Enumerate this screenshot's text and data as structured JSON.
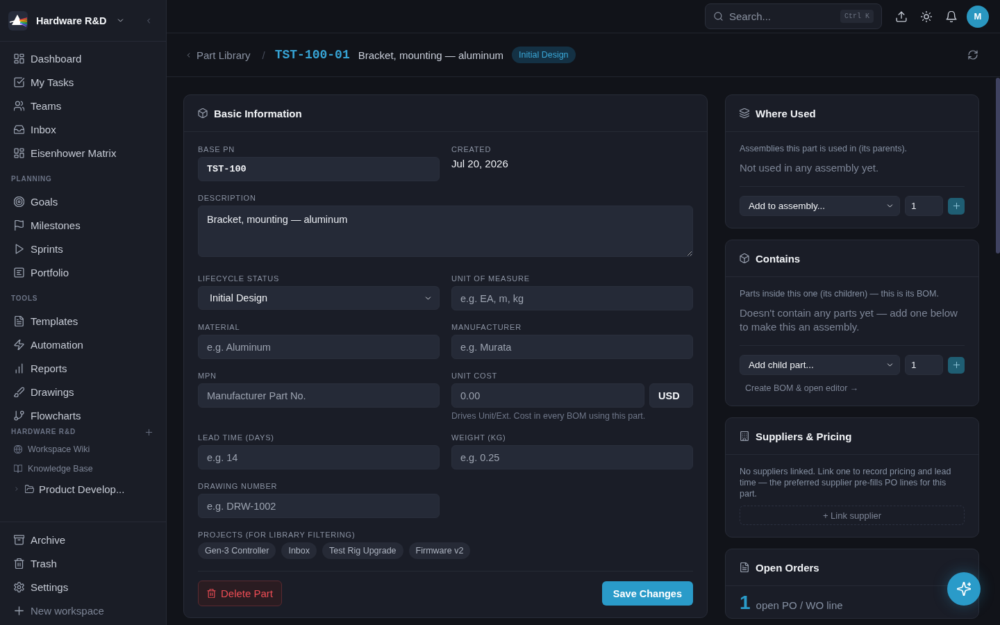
{
  "sidebar": {
    "workspace": "Hardware R&D",
    "main_nav": [
      {
        "label": "Dashboard",
        "selected": false
      },
      {
        "label": "My Tasks",
        "selected": false
      },
      {
        "label": "Teams",
        "selected": false
      },
      {
        "label": "Inbox",
        "selected": false
      },
      {
        "label": "Eisenhower Matrix",
        "selected": false
      }
    ],
    "sections": [
      {
        "title": "PLANNING",
        "items": [
          {
            "label": "Goals",
            "selected": false
          },
          {
            "label": "Milestones",
            "selected": false
          },
          {
            "label": "Sprints",
            "selected": false
          },
          {
            "label": "Portfolio",
            "selected": false
          }
        ]
      },
      {
        "title": "TOOLS",
        "items": [
          {
            "label": "Templates",
            "selected": false
          },
          {
            "label": "Automation",
            "selected": false
          },
          {
            "label": "Reports",
            "selected": false
          },
          {
            "label": "Drawings",
            "selected": false
          },
          {
            "label": "Flowcharts",
            "selected": false
          }
        ]
      }
    ],
    "workspace_pages": {
      "title": "HARDWARE R&D",
      "pages": [
        {
          "label": "Workspace Wiki",
          "selected": false
        },
        {
          "label": "Knowledge Base",
          "selected": false
        }
      ],
      "folders": [
        {
          "label": "Product Develop...",
          "expanded": false
        }
      ]
    },
    "footer_nav": [
      {
        "label": "Archive",
        "selected": false
      },
      {
        "label": "Trash",
        "selected": false
      },
      {
        "label": "Settings",
        "selected": false
      }
    ],
    "new_workspace": "New workspace"
  },
  "top_bar": {
    "search": {
      "placeholder": "Search...",
      "shortcut": "Ctrl K"
    },
    "avatar": "M"
  },
  "breadcrumb": {
    "back": "Part Library",
    "separator": "/",
    "part_number": "TST-100-01",
    "title": "Bracket, mounting — aluminum",
    "status": "Initial Design"
  },
  "basic_information": {
    "title": "Basic Information",
    "fields": [
      {
        "kind": "code",
        "label": "BASE PN",
        "value": "TST-100"
      },
      {
        "kind": "static",
        "label": "CREATED",
        "value": "Jul 20, 2026"
      },
      {
        "kind": "textarea",
        "label": "DESCRIPTION",
        "value": "Bracket, mounting — aluminum"
      },
      {
        "kind": "select",
        "label": "LIFECYCLE STATUS",
        "value": "Initial Design"
      },
      {
        "kind": "text",
        "label": "UNIT OF MEASURE",
        "placeholder": "e.g. EA, m, kg"
      },
      {
        "kind": "text",
        "label": "MATERIAL",
        "placeholder": "e.g. Aluminum"
      },
      {
        "kind": "text",
        "label": "MANUFACTURER",
        "placeholder": "e.g. Murata"
      },
      {
        "kind": "text",
        "label": "MPN",
        "placeholder": "Manufacturer Part No."
      },
      {
        "kind": "money",
        "label": "UNIT COST",
        "placeholder": "0.00",
        "currency": "USD",
        "hint": "Drives Unit/Ext. Cost in every BOM using this part."
      },
      {
        "kind": "text",
        "label": "LEAD TIME (DAYS)",
        "placeholder": "e.g. 14"
      },
      {
        "kind": "text",
        "label": "WEIGHT (KG)",
        "placeholder": "e.g. 0.25"
      },
      {
        "kind": "text",
        "label": "DRAWING NUMBER",
        "placeholder": "e.g. DRW-1002"
      }
    ],
    "projects": {
      "label": "PROJECTS (FOR LIBRARY FILTERING)",
      "tags": [
        "Gen-3 Controller",
        "Inbox",
        "Test Rig Upgrade",
        "Firmware v2"
      ]
    },
    "delete": "Delete Part",
    "save": "Save Changes"
  },
  "panels": [
    {
      "kind": "usage",
      "title": "Where Used",
      "note": "Assemblies this part is used in (its parents).",
      "empty": "Not used in any assembly yet.",
      "select": "Add to assembly...",
      "quantity": "1"
    },
    {
      "kind": "bom",
      "title": "Contains",
      "note": "Parts inside this one (its children) — this is its BOM.",
      "empty": "Doesn't contain any parts yet — add one below to make this an assembly.",
      "select": "Add child part...",
      "quantity": "1",
      "link": "Create BOM & open editor →"
    },
    {
      "kind": "suppliers",
      "title": "Suppliers & Pricing",
      "note": "No suppliers linked. Link one to record pricing and lead time — the preferred supplier pre-fills PO lines for this part.",
      "action": "+ Link supplier"
    },
    {
      "kind": "orders",
      "title": "Open Orders",
      "count": "1",
      "count_label": "open PO / WO line"
    }
  ]
}
